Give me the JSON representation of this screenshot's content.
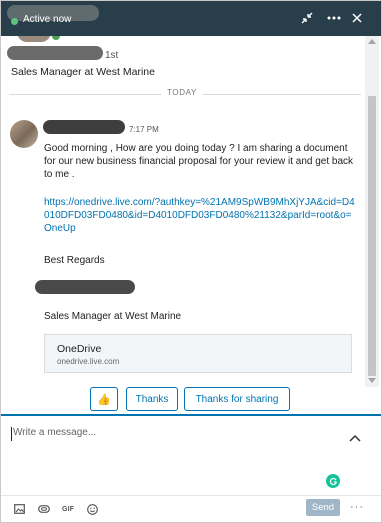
{
  "header": {
    "status": "Active now",
    "icons": [
      "minimize-arrows-icon",
      "ellipsis-icon",
      "close-icon"
    ]
  },
  "profile": {
    "degree": "1st",
    "headline": "Sales Manager at West Marine"
  },
  "divider_label": "TODAY",
  "message": {
    "time": "7:17 PM",
    "body": "Good morning , How are you doing today ? I am sharing a document for our new business financial proposal for your review it and get back to me .",
    "link": "https://onedrive.live.com/?authkey=%21AM9SpWB9MhXjYJA&cid=D4010DFD03FD0480&id=D4010DFD03FD0480%21132&parId=root&o=OneUp",
    "regards": "Best Regards",
    "signature_title": "Sales Manager at West Marine",
    "card": {
      "title": "OneDrive",
      "domain": "onedrive.live.com"
    }
  },
  "quick_replies": {
    "thumbs": "👍",
    "thanks": "Thanks",
    "thanks_for_sharing": "Thanks for sharing"
  },
  "compose": {
    "placeholder": "Write a message..."
  },
  "toolbar": {
    "gif": "GIF",
    "send": "Send",
    "more": "···"
  },
  "colors": {
    "header_bg": "#283e4a",
    "accent": "#0073b1",
    "online": "#5ec47a",
    "send_disabled": "#a0b6c6"
  }
}
